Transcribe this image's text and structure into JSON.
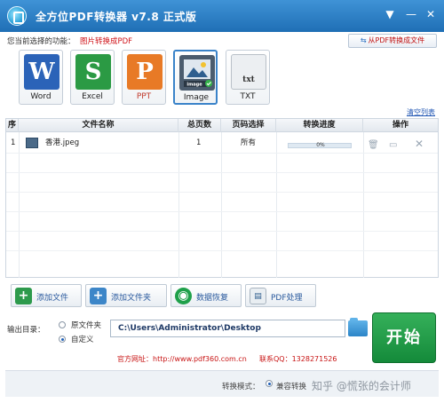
{
  "window": {
    "title": "全方位PDF转换器 v7.8 正式版"
  },
  "function": {
    "label": "您当前选择的功能：",
    "value": "图片转换成PDF"
  },
  "from_pdf_button": "从PDF转换成文件",
  "formats": [
    {
      "name": "Word",
      "letter": "W",
      "color": "#2b63b8"
    },
    {
      "name": "Excel",
      "letter": "S",
      "color": "#2b9a44"
    },
    {
      "name": "PPT",
      "letter": "P",
      "color": "#e87a26"
    },
    {
      "name": "Image",
      "letter": "",
      "color": "#5a6b7d",
      "selected": true,
      "tag": "image"
    },
    {
      "name": "TXT",
      "letter": "txt",
      "color": "#d9dde2"
    }
  ],
  "table": {
    "clear_label": "清空列表",
    "headers": [
      "序",
      "文件名称",
      "总页数",
      "页码选择",
      "转换进度",
      "操作"
    ],
    "rows": [
      {
        "index": "1",
        "filename": "香港.jpeg",
        "pages": "1",
        "page_select": "所有",
        "progress_text": "0%",
        "progress": 0
      }
    ]
  },
  "toolbar": {
    "add_file": "添加文件",
    "add_folder": "添加文件夹",
    "recover": "数据恢复",
    "pdf_process": "PDF处理"
  },
  "output": {
    "label": "输出目录：",
    "option_source": "原文件夹",
    "option_custom": "自定义",
    "path": "C:\\Users\\Administrator\\Desktop"
  },
  "start_button": "开始",
  "footer": {
    "website": "官方网址：http://www.pdf360.com.cn",
    "qq": "联系QQ：1328271526"
  },
  "status": {
    "mode_label": "转换模式：",
    "mode_value": "兼容转换",
    "watermark": "知乎 @慌张的会计师"
  }
}
